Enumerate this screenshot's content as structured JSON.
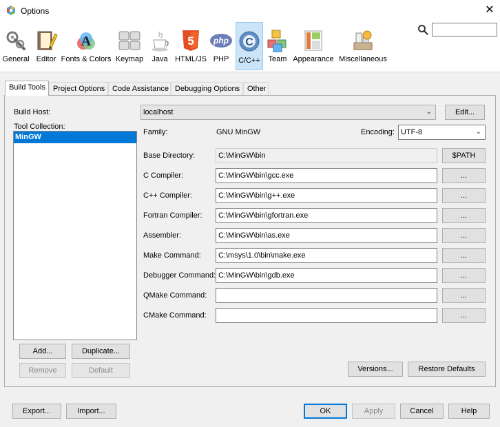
{
  "window": {
    "title": "Options",
    "close": "✕"
  },
  "toolbar": {
    "items": [
      {
        "label": "General",
        "icon": "general-icon"
      },
      {
        "label": "Editor",
        "icon": "editor-icon"
      },
      {
        "label": "Fonts & Colors",
        "icon": "fonts-colors-icon"
      },
      {
        "label": "Keymap",
        "icon": "keymap-icon"
      },
      {
        "label": "Java",
        "icon": "java-icon"
      },
      {
        "label": "HTML/JS",
        "icon": "html5-icon",
        "glyph": "5"
      },
      {
        "label": "PHP",
        "icon": "php-icon",
        "glyph": "php"
      },
      {
        "label": "C/C++",
        "icon": "cpp-icon",
        "glyph": "C"
      },
      {
        "label": "Team",
        "icon": "team-icon"
      },
      {
        "label": "Appearance",
        "icon": "appearance-icon"
      },
      {
        "label": "Miscellaneous",
        "icon": "miscellaneous-icon"
      }
    ],
    "selected": "C/C++",
    "search_placeholder": ""
  },
  "tabs": [
    "Build Tools",
    "Project Options",
    "Code Assistance",
    "Debugging Options",
    "Other"
  ],
  "active_tab": "Build Tools",
  "build_tools": {
    "build_host_label": "Build Host:",
    "build_host_value": "localhost",
    "edit_button": "Edit...",
    "tool_collection_label": "Tool Collection:",
    "tool_collections": [
      "MinGW"
    ],
    "family_label": "Family:",
    "family_value": "GNU MinGW",
    "encoding_label": "Encoding:",
    "encoding_value": "UTF-8",
    "path_button": "$PATH",
    "browse_button": "...",
    "fields": [
      {
        "label": "Base Directory:",
        "value": "C:\\MinGW\\bin"
      },
      {
        "label": "C Compiler:",
        "value": "C:\\MinGW\\bin\\gcc.exe"
      },
      {
        "label": "C++ Compiler:",
        "value": "C:\\MinGW\\bin\\g++.exe"
      },
      {
        "label": "Fortran Compiler:",
        "value": "C:\\MinGW\\bin\\gfortran.exe"
      },
      {
        "label": "Assembler:",
        "value": "C:\\MinGW\\bin\\as.exe"
      },
      {
        "label": "Make Command:",
        "value": "C:\\msys\\1.0\\bin\\make.exe"
      },
      {
        "label": "Debugger Command:",
        "value": "C:\\MinGW\\bin\\gdb.exe"
      },
      {
        "label": "QMake Command:",
        "value": ""
      },
      {
        "label": "CMake Command:",
        "value": ""
      }
    ],
    "add_button": "Add...",
    "duplicate_button": "Duplicate...",
    "remove_button": "Remove",
    "default_button": "Default",
    "versions_button": "Versions...",
    "restore_defaults_button": "Restore Defaults"
  },
  "footer": {
    "export": "Export...",
    "import": "Import...",
    "ok": "OK",
    "apply": "Apply",
    "cancel": "Cancel",
    "help": "Help"
  }
}
